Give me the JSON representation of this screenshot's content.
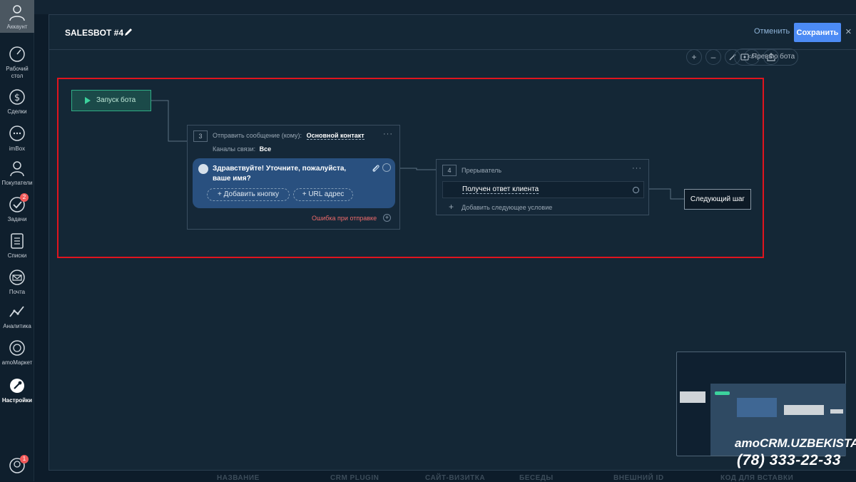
{
  "sidebar": {
    "items": [
      {
        "label": "Аккаунт",
        "icon": "user-icon"
      },
      {
        "label": "Рабочий стол",
        "icon": "dashboard-icon"
      },
      {
        "label": "Сделки",
        "icon": "dollar-icon"
      },
      {
        "label": "imBox",
        "icon": "chat-icon"
      },
      {
        "label": "Покупатели",
        "icon": "customers-icon"
      },
      {
        "label": "Задачи",
        "icon": "tasks-icon",
        "badge": "2"
      },
      {
        "label": "Списки",
        "icon": "lists-icon"
      },
      {
        "label": "Почта",
        "icon": "mail-icon"
      },
      {
        "label": "Аналитика",
        "icon": "analytics-icon"
      },
      {
        "label": "amoМаркет",
        "icon": "market-icon"
      },
      {
        "label": "Настройки",
        "icon": "settings-icon"
      }
    ],
    "bottom_badge": "1"
  },
  "modal": {
    "title": "SALESBOT #4",
    "cancel_label": "Отменить",
    "save_label": "Сохранить",
    "close_label": "×"
  },
  "toolbar": {
    "zoom_in": "+",
    "zoom_out": "–",
    "code_label": "</>",
    "preview_label": "Превью бота"
  },
  "canvas": {
    "start_node": {
      "label": "Запуск бота"
    },
    "message_node": {
      "step": "3",
      "send_label": "Отправить сообщение (кому):",
      "recipient": "Основной контакт",
      "channels_label": "Каналы связи:",
      "channels_value": "Все",
      "message_text": "Здравствуйте! Уточните, пожалуйста, ваше имя?",
      "add_button": "+ Добавить кнопку",
      "url_button": "+ URL адрес",
      "error_label": "Ошибка при отправке",
      "menu": "···"
    },
    "interrupt_node": {
      "step": "4",
      "title": "Прерыватель",
      "condition": "Получен ответ клиента",
      "add_condition": "Добавить следующее условие",
      "menu": "···"
    },
    "next_node": {
      "label": "Следующий шаг"
    }
  },
  "background_columns": [
    "НАЗВАНИЕ",
    "CRM PLUGIN",
    "САЙТ-ВИЗИТКА",
    "БЕСЕДЫ",
    "ВНЕШНИЙ ID",
    "КОД ДЛЯ ВСТАВКИ"
  ],
  "watermark": {
    "brand": "amoCRM.UZBEKISTAN",
    "phone": "(78) 333-22-33"
  },
  "colors": {
    "accent": "#4c8bf5",
    "highlight": "#e0141e",
    "start_green": "#2fae86",
    "bubble": "#29507f",
    "error": "#ef6a6a"
  }
}
